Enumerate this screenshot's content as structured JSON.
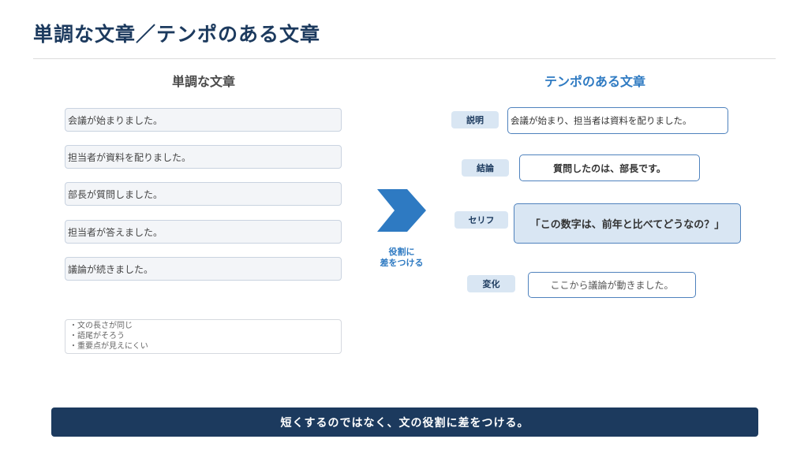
{
  "title": "単調な文章／テンポのある文章",
  "left": {
    "heading": "単調な文章",
    "sentences": [
      "会議が始まりました。",
      "担当者が資料を配りました。",
      "部長が質問しました。",
      "担当者が答えました。",
      "議論が続きました。"
    ],
    "notes": [
      "・文の長さが同じ",
      "・語尾がそろう",
      "・重要点が見えにくい"
    ]
  },
  "arrow": {
    "label_line1": "役割に",
    "label_line2": "差をつける",
    "color": "#2e7ac2"
  },
  "right": {
    "heading": "テンポのある文章",
    "items": [
      {
        "role": "説明",
        "text": "会議が始まり、担当者は資料を配りました。"
      },
      {
        "role": "結論",
        "text": "質問したのは、部長です。"
      },
      {
        "role": "セリフ",
        "text": "「この数字は、前年と比べてどうなの？」"
      },
      {
        "role": "変化",
        "text": "ここから議論が動きました。"
      }
    ]
  },
  "footer": {
    "text": "短くするのではなく、文の役割に差をつける。"
  },
  "colors": {
    "navy": "#1c3a5e",
    "accent_blue": "#2e7ac2",
    "tag_bg": "#d9e6f3"
  }
}
